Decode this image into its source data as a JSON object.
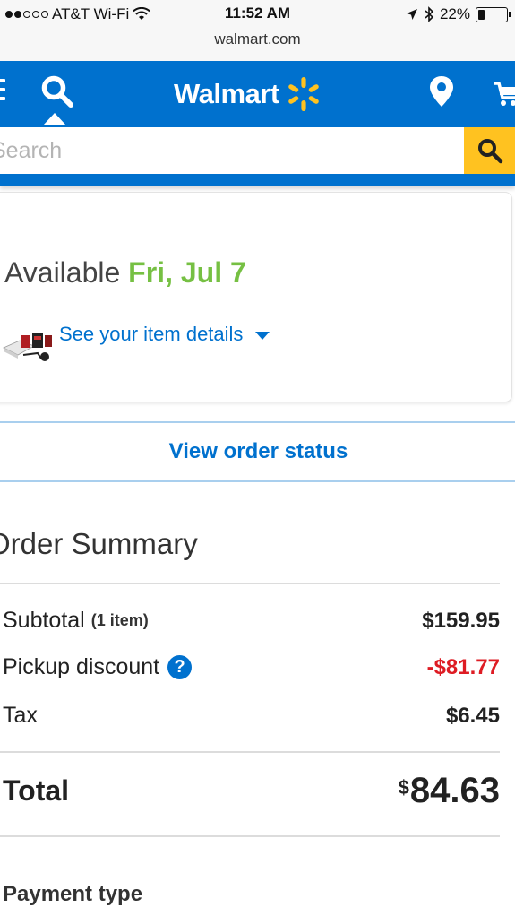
{
  "status_bar": {
    "carrier": "AT&T Wi-Fi",
    "time": "11:52 AM",
    "battery": "22%",
    "battery_level": 0.22
  },
  "browser": {
    "url": "walmart.com"
  },
  "header": {
    "brand": "Walmart",
    "brand_color": "#0071ce",
    "spark_color": "#ffc220"
  },
  "search": {
    "placeholder": "Search"
  },
  "availability": {
    "label": "Available",
    "date": "Fri, Jul 7",
    "details_link": "See your item details"
  },
  "order_status_button": "View order status",
  "order_summary": {
    "title": "Order Summary",
    "subtotal_label": "Subtotal",
    "subtotal_items": "(1 item)",
    "subtotal_value": "$159.95",
    "discount_label": "Pickup discount",
    "discount_value": "-$81.77",
    "tax_label": "Tax",
    "tax_value": "$6.45",
    "total_label": "Total",
    "total_currency": "$",
    "total_value": "84.63"
  },
  "payment_type_label": "Payment type"
}
